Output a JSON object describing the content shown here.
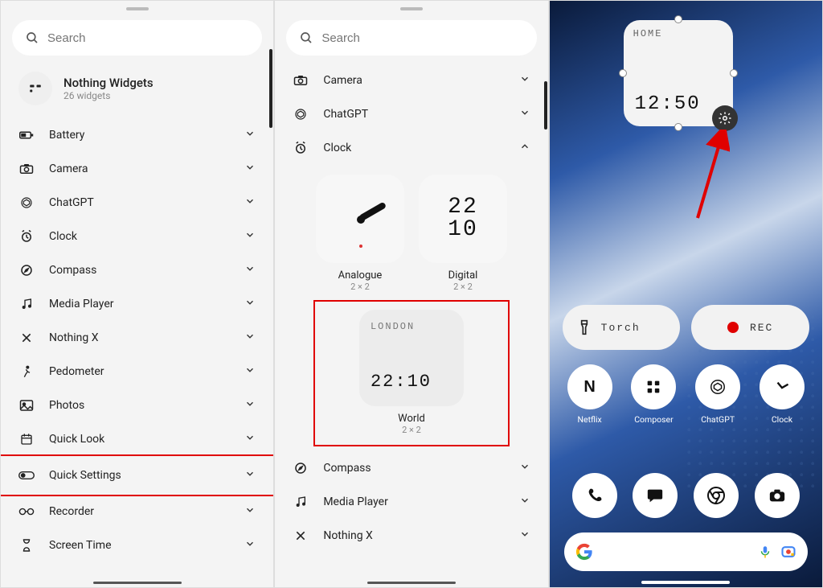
{
  "search": {
    "placeholder": "Search"
  },
  "panel1": {
    "header": {
      "title": "Nothing Widgets",
      "subtitle": "26 widgets"
    },
    "items": [
      {
        "label": "Battery"
      },
      {
        "label": "Camera"
      },
      {
        "label": "ChatGPT"
      },
      {
        "label": "Clock"
      },
      {
        "label": "Compass"
      },
      {
        "label": "Media Player"
      },
      {
        "label": "Nothing X"
      },
      {
        "label": "Pedometer"
      },
      {
        "label": "Photos"
      },
      {
        "label": "Quick Look"
      },
      {
        "label": "Quick Settings"
      },
      {
        "label": "Recorder"
      },
      {
        "label": "Screen Time"
      }
    ]
  },
  "panel2": {
    "top_items": [
      {
        "label": "Camera"
      },
      {
        "label": "ChatGPT"
      },
      {
        "label": "Clock"
      }
    ],
    "widgets": {
      "analogue": {
        "label": "Analogue",
        "size": "2 × 2"
      },
      "digital": {
        "label": "Digital",
        "size": "2 × 2",
        "line1": "22",
        "line2": "10"
      },
      "world": {
        "label": "World",
        "size": "2 × 2",
        "city": "LONDON",
        "time": "22:10"
      }
    },
    "bottom_items": [
      {
        "label": "Compass"
      },
      {
        "label": "Media Player"
      },
      {
        "label": "Nothing X"
      }
    ]
  },
  "panel3": {
    "home_widget": {
      "label": "HOME",
      "time": "12:50"
    },
    "pills": {
      "torch": "Torch",
      "rec": "REC"
    },
    "apps": [
      {
        "label": "Netflix"
      },
      {
        "label": "Composer"
      },
      {
        "label": "ChatGPT"
      },
      {
        "label": "Clock"
      }
    ]
  }
}
